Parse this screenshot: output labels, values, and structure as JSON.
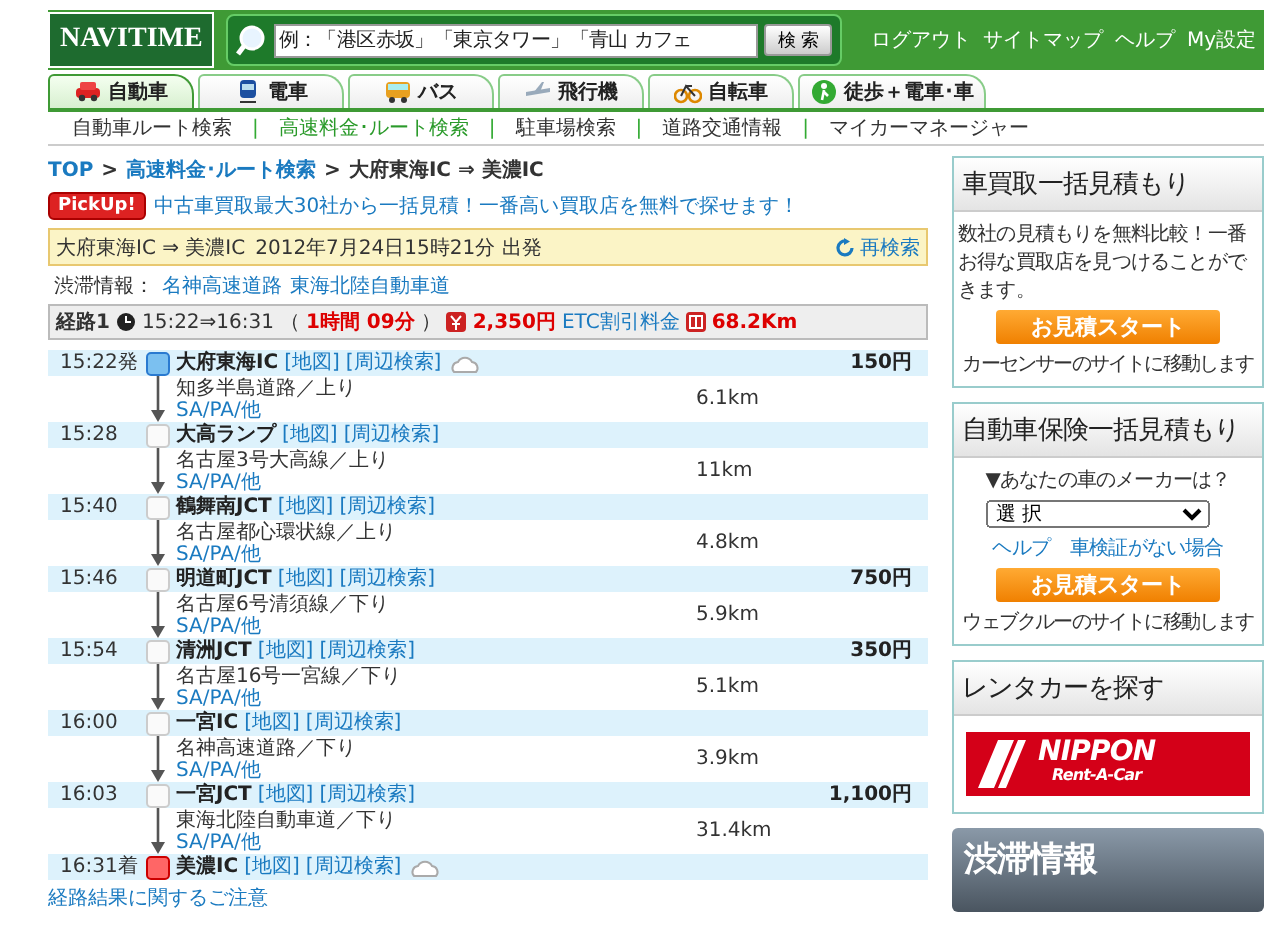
{
  "header": {
    "logo": "NAVITIME",
    "search_placeholder": "例：「港区赤坂」「東京タワー」「青山 カフェ",
    "search_button": "検 索",
    "links": [
      "ログアウト",
      "サイトマップ",
      "ヘルプ",
      "My設定"
    ]
  },
  "tabs": [
    {
      "label": "自動車",
      "selected": true
    },
    {
      "label": "電車",
      "selected": false
    },
    {
      "label": "バス",
      "selected": false
    },
    {
      "label": "飛行機",
      "selected": false
    },
    {
      "label": "自転車",
      "selected": false
    },
    {
      "label": "徒歩＋電車･車",
      "selected": false
    }
  ],
  "subnav": {
    "separator": "|",
    "items": [
      {
        "label": "自動車ルート検索",
        "selected": false
      },
      {
        "label": "高速料金･ルート検索",
        "selected": true
      },
      {
        "label": "駐車場検索",
        "selected": false
      },
      {
        "label": "道路交通情報",
        "selected": false
      },
      {
        "label": "マイカーマネージャー",
        "selected": false
      }
    ]
  },
  "breadcrumb": {
    "separator": ">",
    "items": [
      "TOP",
      "高速料金･ルート検索",
      "大府東海IC ⇒ 美濃IC"
    ]
  },
  "pickup": {
    "badge": "PickUp!",
    "text": "中古車買取最大30社から一括見積！一番高い買取店を無料で探せます！"
  },
  "summary": {
    "route": "大府東海IC ⇒ 美濃IC",
    "departure": "2012年7月24日15時21分 出発",
    "research": "再検索"
  },
  "congestion": {
    "label": "渋滞情報：",
    "links": [
      "名神高速道路",
      "東海北陸自動車道"
    ]
  },
  "route_header": {
    "label": "経路1",
    "time": "15:22⇒16:31",
    "open": "（",
    "duration": "1時間 09分",
    "close": "）",
    "fare": "2,350円",
    "fare_note": "ETC割引料金",
    "distance": "68.2Km"
  },
  "stops": [
    {
      "kind": "start",
      "time": "15:22発",
      "name": "大府東海IC",
      "map": "[地図]",
      "nearby": "[周辺検索]",
      "weather": true,
      "fare": "150円",
      "segment": {
        "road": "知多半島道路／上り",
        "sapa": "SA/PA/他",
        "distance": "6.1km"
      }
    },
    {
      "kind": "via",
      "time": "15:28",
      "name": "大高ランプ",
      "map": "[地図]",
      "nearby": "[周辺検索]",
      "weather": false,
      "segment": {
        "road": "名古屋3号大高線／上り",
        "sapa": "SA/PA/他",
        "distance": "11km"
      }
    },
    {
      "kind": "via",
      "time": "15:40",
      "name": "鶴舞南JCT",
      "map": "[地図]",
      "nearby": "[周辺検索]",
      "weather": false,
      "segment": {
        "road": "名古屋都心環状線／上り",
        "sapa": "SA/PA/他",
        "distance": "4.8km"
      }
    },
    {
      "kind": "via",
      "time": "15:46",
      "name": "明道町JCT",
      "map": "[地図]",
      "nearby": "[周辺検索]",
      "weather": false,
      "fare": "750円",
      "segment": {
        "road": "名古屋6号清須線／下り",
        "sapa": "SA/PA/他",
        "distance": "5.9km"
      }
    },
    {
      "kind": "via",
      "time": "15:54",
      "name": "清洲JCT",
      "map": "[地図]",
      "nearby": "[周辺検索]",
      "weather": false,
      "fare": "350円",
      "segment": {
        "road": "名古屋16号一宮線／下り",
        "sapa": "SA/PA/他",
        "distance": "5.1km"
      }
    },
    {
      "kind": "via",
      "time": "16:00",
      "name": "一宮IC",
      "map": "[地図]",
      "nearby": "[周辺検索]",
      "weather": false,
      "segment": {
        "road": "名神高速道路／下り",
        "sapa": "SA/PA/他",
        "distance": "3.9km"
      }
    },
    {
      "kind": "via",
      "time": "16:03",
      "name": "一宮JCT",
      "map": "[地図]",
      "nearby": "[周辺検索]",
      "weather": false,
      "fare": "1,100円",
      "segment": {
        "road": "東海北陸自動車道／下り",
        "sapa": "SA/PA/他",
        "distance": "31.4km"
      }
    },
    {
      "kind": "end",
      "time": "16:31着",
      "name": "美濃IC",
      "map": "[地図]",
      "nearby": "[周辺検索]",
      "weather": true
    }
  ],
  "note": "経路結果に関するご注意",
  "sidebar": {
    "buy_card": {
      "title": "車買取一括見積もり",
      "text": "数社の見積もりを無料比較！一番お得な買取店を見つけることができます。",
      "button": "お見積スタート",
      "footer": "カーセンサーのサイトに移動します"
    },
    "insurance_card": {
      "title": "自動車保険一括見積もり",
      "question": "▼あなたの車のメーカーは？",
      "select": "選 択",
      "links": [
        "ヘルプ",
        "車検証がない場合"
      ],
      "button": "お見積スタート",
      "footer": "ウェブクルーのサイトに移動します"
    },
    "rental_card": {
      "title": "レンタカーを探す",
      "logo_main": "NIPPON",
      "logo_sub": "Rent-A-Car"
    },
    "traffic_banner": {
      "title": "渋滞情報"
    }
  }
}
